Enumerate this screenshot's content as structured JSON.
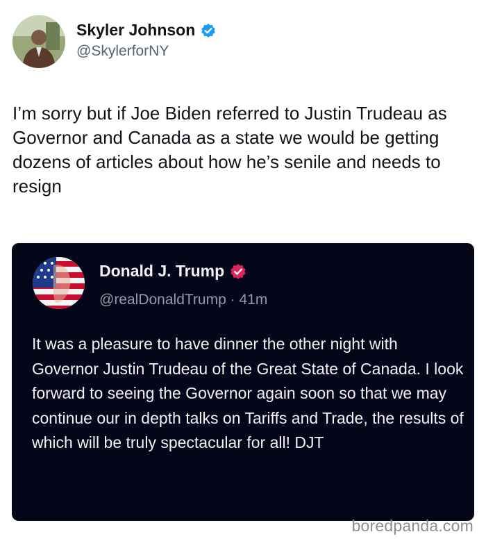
{
  "author": {
    "name": "Skyler Johnson",
    "handle": "@SkylerforNY",
    "verified_color": "#1d9bf0"
  },
  "tweet": {
    "text": "I’m sorry but if Joe Biden referred to Justin Trudeau as Governor and Canada as a state we would be getting dozens of articles about how he’s senile and needs to resign"
  },
  "quoted_post": {
    "name": "Donald J. Trump",
    "handle": "@realDonaldTrump",
    "separator": "·",
    "time": "41m",
    "verified_color": "#e0245e",
    "background": "#06061a",
    "text": "It was a pleasure to have dinner the other night with Governor Justin Trudeau of the Great State of Canada. I look forward to seeing the Governor again soon so that we may continue our in depth talks on Tariffs and Trade, the results of which will be truly spectacular for all! DJT"
  },
  "watermark": {
    "text": "boredpanda.com"
  }
}
